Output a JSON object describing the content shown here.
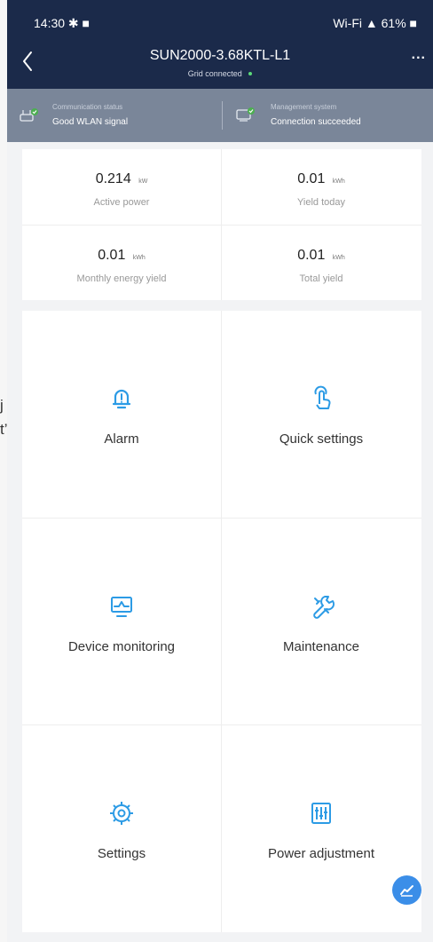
{
  "status_bar": {
    "time": "14:30 ✱ ■",
    "indicators": "Wi-Fi ▲ 61% ■"
  },
  "header": {
    "title": "SUN2000-3.68KTL-L1",
    "subtitle": "Grid connected",
    "background_color": "#1b2a4a"
  },
  "communication": {
    "left": {
      "label": "Communication status",
      "value": "Good WLAN signal"
    },
    "right": {
      "label": "Management system",
      "value": "Connection succeeded"
    },
    "background_color": "#7a8699"
  },
  "stats": [
    {
      "value": "0.214",
      "unit": "kW",
      "label": "Active power"
    },
    {
      "value": "0.01",
      "unit": "kWh",
      "label": "Yield today"
    },
    {
      "value": "0.01",
      "unit": "kWh",
      "label": "Monthly energy yield"
    },
    {
      "value": "0.01",
      "unit": "kWh",
      "label": "Total yield"
    }
  ],
  "menu": [
    {
      "label": "Alarm",
      "icon": "alarm-icon"
    },
    {
      "label": "Quick settings",
      "icon": "quick-settings-icon"
    },
    {
      "label": "Device monitoring",
      "icon": "device-monitoring-icon"
    },
    {
      "label": "Maintenance",
      "icon": "maintenance-icon"
    },
    {
      "label": "Settings",
      "icon": "settings-icon"
    },
    {
      "label": "Power adjustment",
      "icon": "power-adjustment-icon"
    }
  ],
  "icons": {
    "back": "back-icon",
    "more": "more-icon",
    "fab": "trend-chart-icon"
  },
  "theme": {
    "accent": "#3b8ee8",
    "status_green": "#5bd97a"
  },
  "left_crop_text": [
    "j",
    "t’,"
  ]
}
